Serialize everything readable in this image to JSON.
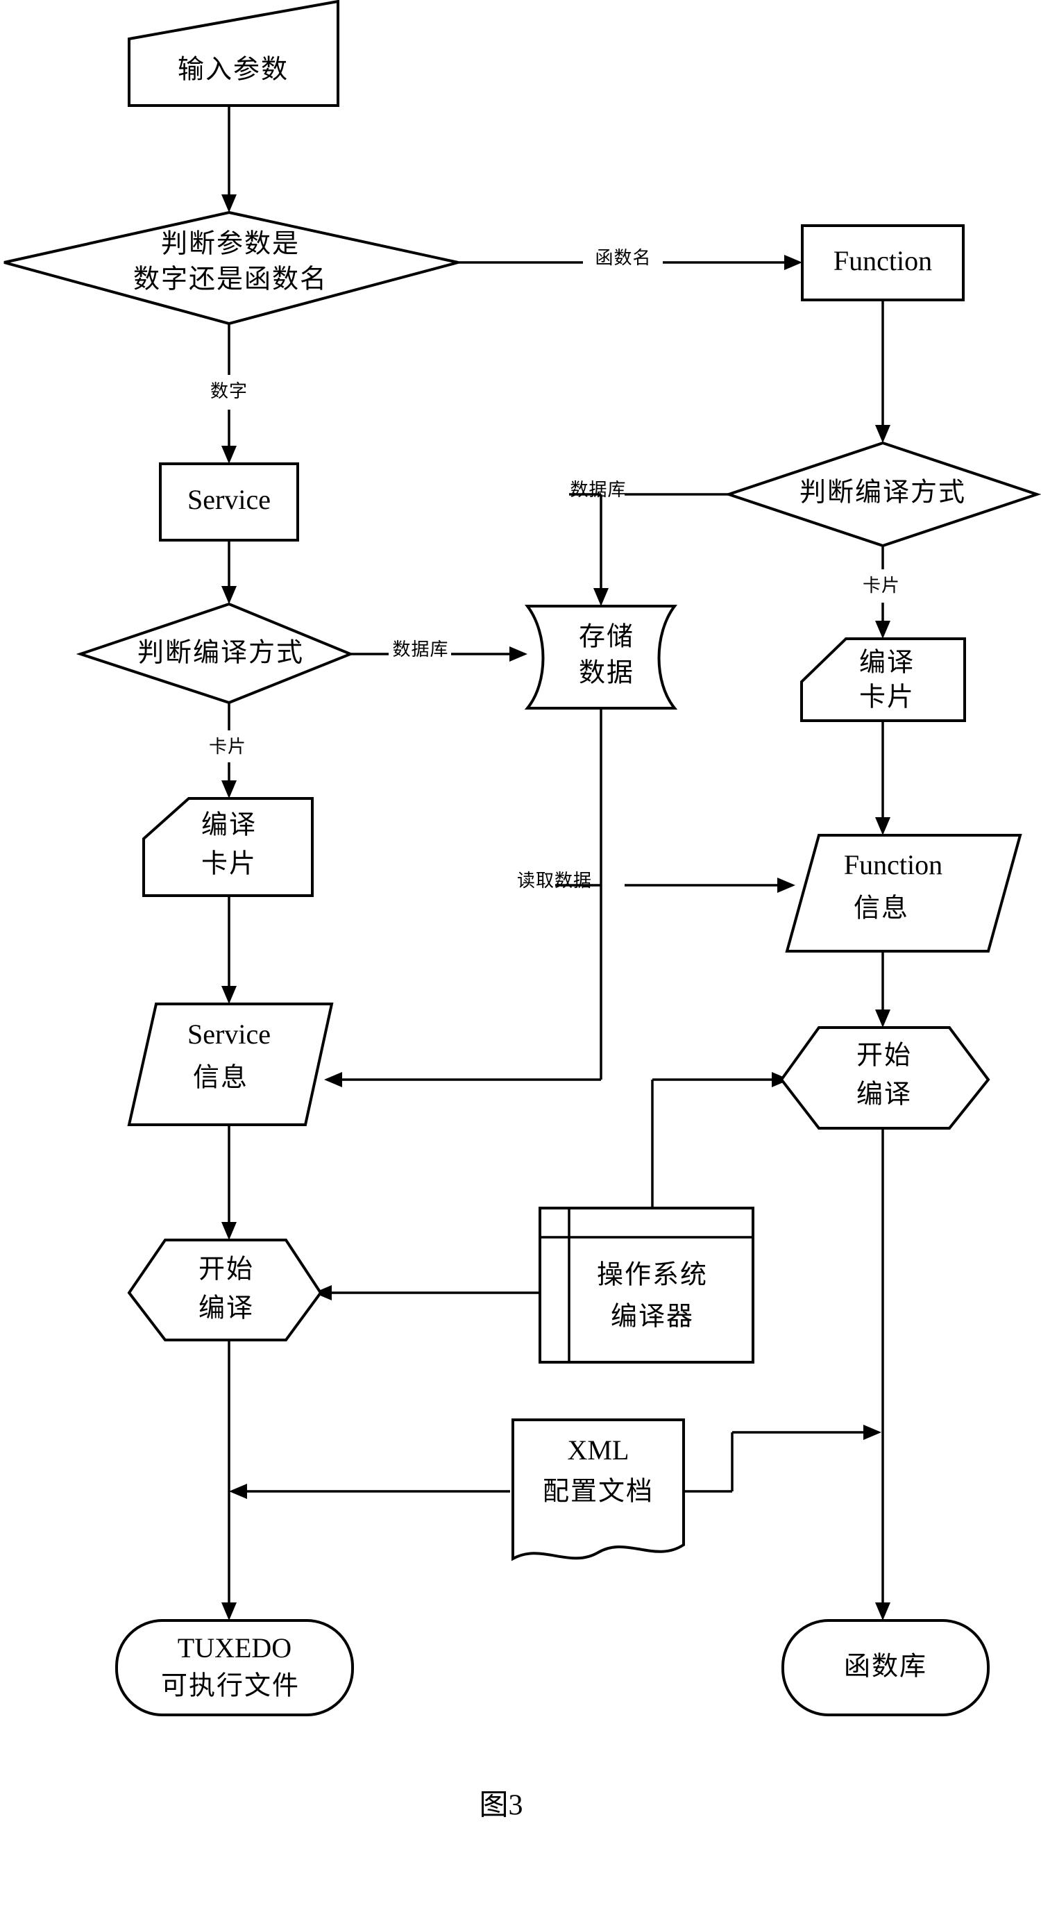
{
  "figure": {
    "caption": "图3"
  },
  "nodes": {
    "input_params": {
      "label": "输入参数",
      "shape": "skewed-rectangle"
    },
    "decide_param_type": {
      "line1": "判断参数是",
      "line2": "数字还是函数名",
      "shape": "diamond"
    },
    "function_box": {
      "label": "Function",
      "shape": "rectangle"
    },
    "service_box": {
      "label": "Service",
      "shape": "rectangle"
    },
    "decide_compile_left": {
      "label": "判断编译方式",
      "shape": "diamond"
    },
    "decide_compile_right": {
      "label": "判断编译方式",
      "shape": "diamond"
    },
    "store_data": {
      "line1": "存储",
      "line2": "数据",
      "shape": "stored-data"
    },
    "compile_card_left": {
      "line1": "编译",
      "line2": "卡片",
      "shape": "notched-rectangle"
    },
    "compile_card_right": {
      "line1": "编译",
      "line2": "卡片",
      "shape": "notched-rectangle"
    },
    "service_info": {
      "line1": "Service",
      "line2": "信息",
      "shape": "parallelogram"
    },
    "function_info": {
      "line1": "Function",
      "line2": "信息",
      "shape": "parallelogram"
    },
    "start_compile_left": {
      "line1": "开始",
      "line2": "编译",
      "shape": "hexagon"
    },
    "start_compile_right": {
      "line1": "开始",
      "line2": "编译",
      "shape": "hexagon"
    },
    "os_compiler": {
      "line1": "操作系统",
      "line2": "编译器",
      "shape": "predefined-process"
    },
    "xml_config": {
      "line1": "XML",
      "line2": "配置文档",
      "shape": "document"
    },
    "tuxedo_exe": {
      "line1": "TUXEDO",
      "line2": "可执行文件",
      "shape": "rounded-terminal"
    },
    "function_lib": {
      "label": "函数库",
      "shape": "rounded-terminal"
    }
  },
  "edge_labels": {
    "function_name": "函数名",
    "number": "数字",
    "database_left": "数据库",
    "database_right": "数据库",
    "card_left": "卡片",
    "card_right": "卡片",
    "read_data": "读取数据"
  },
  "colors": {
    "stroke": "#000000",
    "fill": "#ffffff",
    "text": "#000000"
  }
}
